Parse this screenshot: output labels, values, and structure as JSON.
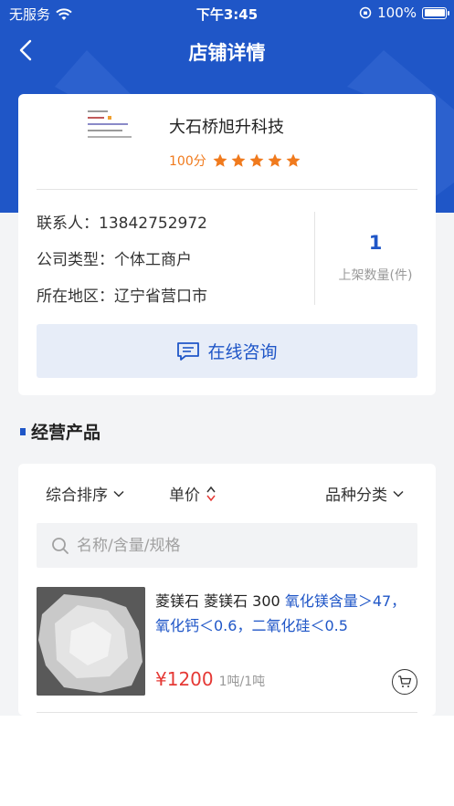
{
  "status_bar": {
    "carrier": "无服务",
    "time": "下午3:45",
    "battery": "100%"
  },
  "nav": {
    "title": "店铺详情"
  },
  "shop": {
    "name": "大石桥旭升科技",
    "score": "100分",
    "rating_stars": 5,
    "contact": "联系人：13842752972",
    "company_type": "公司类型：个体工商户",
    "region": "所在地区：辽宁省营口市",
    "listed_count": "1",
    "listed_label": "上架数量(件)",
    "consult_label": "在线咨询"
  },
  "products_section": {
    "title": "经营产品",
    "filters": {
      "sort": "综合排序",
      "price": "单价",
      "category": "品种分类"
    },
    "search_placeholder": "名称/含量/规格",
    "items": [
      {
        "name": "菱镁石 菱镁石 300 ",
        "spec": "氧化镁含量＞47，氧化钙＜0.6，二氧化硅＜0.5",
        "price": "¥1200",
        "unit": "1吨/1吨"
      }
    ]
  },
  "colors": {
    "brand": "#1f56c7",
    "accent_orange": "#f07a1d",
    "price_red": "#e53935"
  },
  "icons": [
    "wifi-icon",
    "orientation-lock-icon",
    "battery-icon",
    "back-arrow-icon",
    "star-icon",
    "chat-icon",
    "chevron-down-icon",
    "sort-icon",
    "search-icon",
    "cart-icon"
  ]
}
